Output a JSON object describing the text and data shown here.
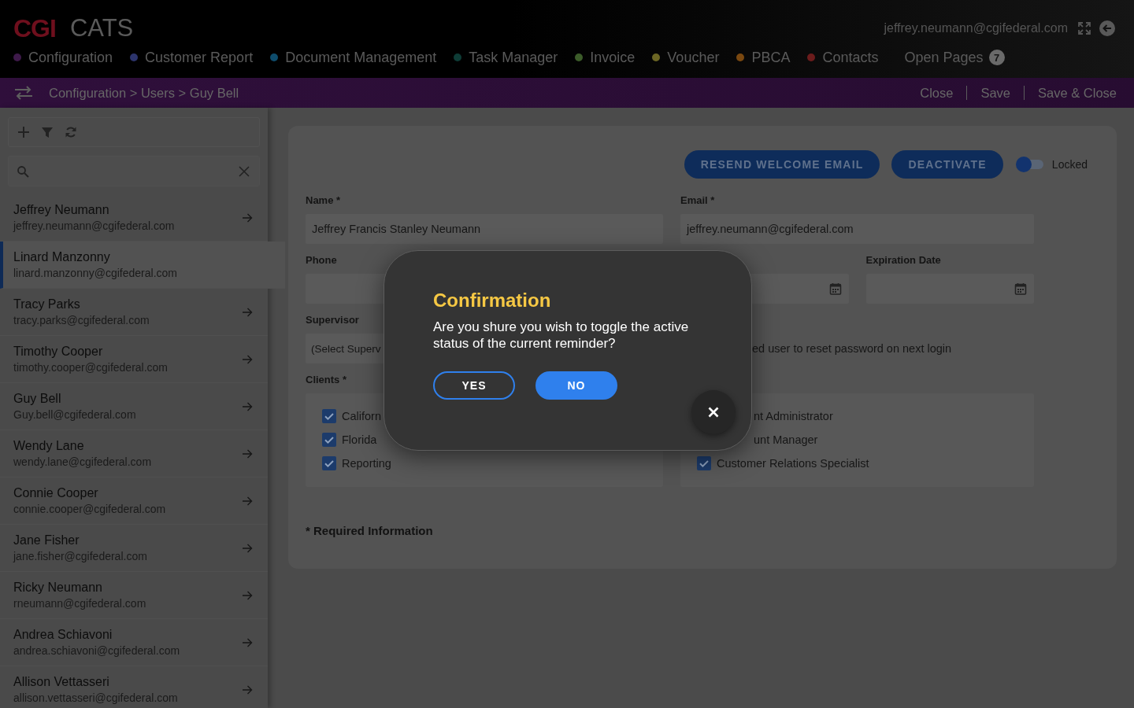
{
  "header": {
    "logo": "CGI",
    "app_name": "CATS",
    "user_email": "jeffrey.neumann@cgifederal.com",
    "nav": [
      {
        "label": "Configuration",
        "color": "#3e1a4a"
      },
      {
        "label": "Customer Report",
        "color": "#2c346c"
      },
      {
        "label": "Document Management",
        "color": "#0e4c6c"
      },
      {
        "label": "Task Manager",
        "color": "#0e3c36"
      },
      {
        "label": "Invoice",
        "color": "#3c5c2a"
      },
      {
        "label": "Voucher",
        "color": "#6c6624"
      },
      {
        "label": "PBCA",
        "color": "#7a4810"
      },
      {
        "label": "Contacts",
        "color": "#6c1c1c"
      }
    ],
    "open_pages": {
      "label": "Open Pages",
      "count": "7"
    }
  },
  "breadcrumb": {
    "path": "Configuration > Users > Guy Bell",
    "actions": [
      "Close",
      "Save",
      "Save & Close"
    ]
  },
  "sidebar": {
    "users": [
      {
        "name": "Jeffrey Neumann",
        "email": "jeffrey.neumann@cgifederal.com",
        "selected": false
      },
      {
        "name": "Linard Manzonny",
        "email": "linard.manzonny@cgifederal.com",
        "selected": true
      },
      {
        "name": "Tracy Parks",
        "email": "tracy.parks@cgifederal.com",
        "selected": false
      },
      {
        "name": "Timothy Cooper",
        "email": "timothy.cooper@cgifederal.com",
        "selected": false
      },
      {
        "name": "Guy Bell",
        "email": "Guy.bell@cgifederal.com",
        "selected": false
      },
      {
        "name": "Wendy Lane",
        "email": "wendy.lane@cgifederal.com",
        "selected": false
      },
      {
        "name": "Connie Cooper",
        "email": "connie.cooper@cgifederal.com",
        "selected": false
      },
      {
        "name": "Jane Fisher",
        "email": "jane.fisher@cgifederal.com",
        "selected": false
      },
      {
        "name": "Ricky Neumann",
        "email": "rneumann@cgifederal.com",
        "selected": false
      },
      {
        "name": "Andrea Schiavoni",
        "email": "andrea.schiavoni@cgifederal.com",
        "selected": false
      },
      {
        "name": "Allison Vettasseri",
        "email": "allison.vettasseri@cgifederal.com",
        "selected": false
      }
    ]
  },
  "form": {
    "actions": [
      "RESEND WELCOME EMAIL",
      "DEACTIVATE"
    ],
    "locked_toggle": {
      "label": "Locked",
      "on": false
    },
    "name": {
      "label": "Name *",
      "value": "Jeffrey Francis Stanley Neumann"
    },
    "email": {
      "label": "Email *",
      "value": "jeffrey.neumann@cgifederal.com"
    },
    "phone": {
      "label": "Phone"
    },
    "expiration_date": {
      "label": "Expiration Date"
    },
    "supervisor": {
      "label": "Supervisor",
      "value": "(Select Superv"
    },
    "reset_password_option": {
      "label": "ed user to reset password on next login"
    },
    "clients": {
      "label": "Clients *",
      "items": [
        {
          "label": "Californ",
          "checked": true
        },
        {
          "label": "Florida",
          "checked": true
        },
        {
          "label": "Reporting",
          "checked": true
        }
      ]
    },
    "roles": {
      "items": [
        {
          "label": "nt Administrator"
        },
        {
          "label": "unt Manager"
        },
        {
          "label": "Customer Relations Specialist",
          "checked": true
        }
      ]
    },
    "required_note": "* Required Information"
  },
  "dialog": {
    "title": "Confirmation",
    "message": "Are you shure you wish to toggle the active status of the current reminder?",
    "buttons": [
      {
        "label": "YES",
        "kind": "outline"
      },
      {
        "label": "NO",
        "kind": "filled"
      }
    ]
  }
}
